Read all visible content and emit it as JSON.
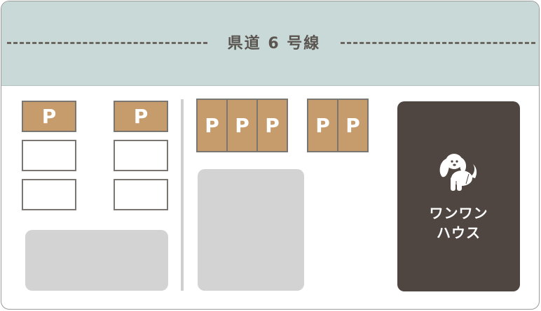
{
  "road": {
    "label": "県道 6 号線"
  },
  "parking": {
    "label": "P"
  },
  "shop": {
    "line1": "ワンワン",
    "line2": "ハウス",
    "icon": "dog-icon"
  },
  "colors": {
    "road": "#c9d9d7",
    "parking": "#c69c6d",
    "shop": "#4f4641",
    "block": "#d3d3d3"
  }
}
